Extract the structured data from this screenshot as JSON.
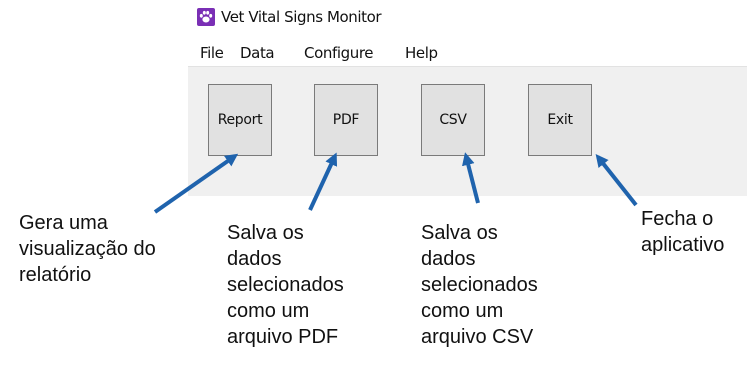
{
  "window": {
    "title": "Vet Vital Signs Monitor",
    "icon": "paw-icon",
    "icon_color": "#7a2fb5"
  },
  "menu": {
    "items": [
      "File",
      "Data",
      "Configure",
      "Help"
    ]
  },
  "buttons": {
    "report": "Report",
    "pdf": "PDF",
    "csv": "CSV",
    "exit": "Exit"
  },
  "annotations": {
    "arrow_color": "#1f63ad",
    "report": [
      "Gera uma",
      "visualização do",
      "relatório"
    ],
    "pdf": [
      "Salva os",
      "dados",
      "selecionados",
      "como um",
      "arquivo PDF"
    ],
    "csv": [
      "Salva os",
      "dados",
      "selecionados",
      "como um",
      "arquivo CSV"
    ],
    "exit": [
      "Fecha o",
      "aplicativo"
    ]
  }
}
